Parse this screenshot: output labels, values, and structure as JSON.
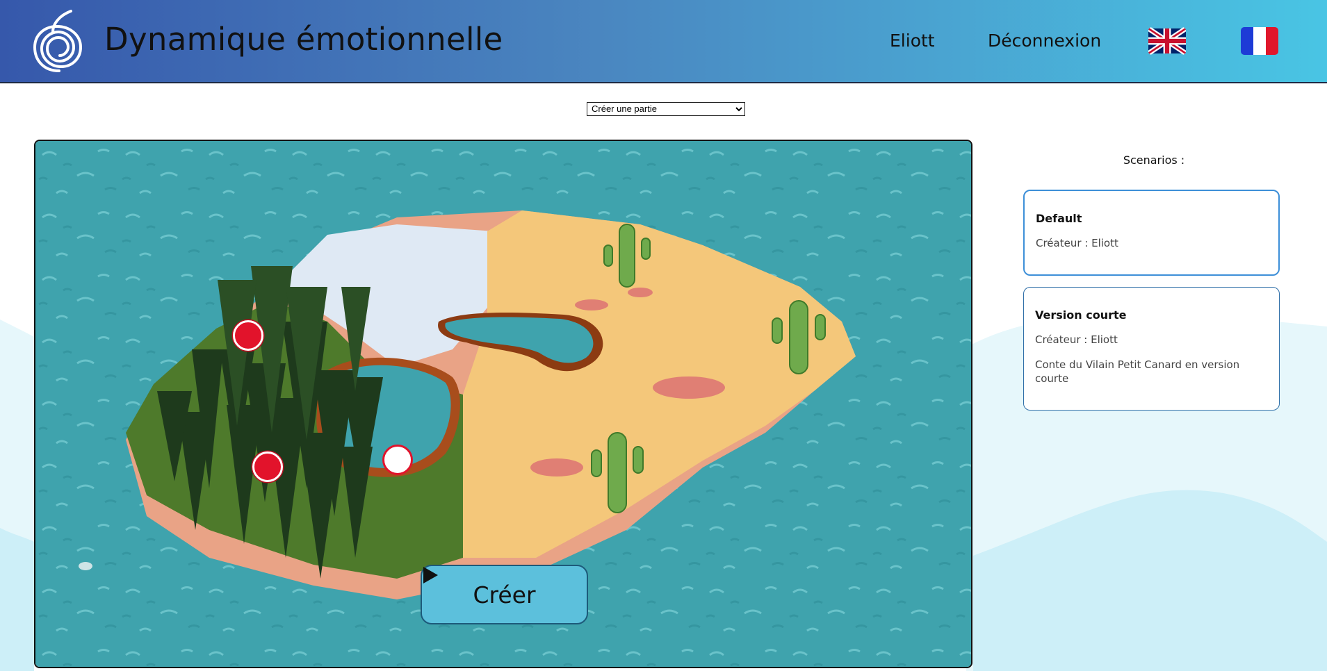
{
  "header": {
    "app_title": "Dynamique émotionnelle",
    "user_name": "Eliott",
    "logout_label": "Déconnexion",
    "flags": [
      "uk-flag-icon",
      "france-flag-icon"
    ]
  },
  "game_mode_select": {
    "selected": "Créer une partie"
  },
  "map": {
    "create_button_label": "Créer",
    "markers": [
      {
        "name": "map-marker-forest-top",
        "state": "active"
      },
      {
        "name": "map-marker-forest-bottom",
        "state": "active"
      },
      {
        "name": "map-marker-pond",
        "state": "inactive"
      }
    ]
  },
  "scenarios": {
    "title": "Scenarios :",
    "items": [
      {
        "name": "Default",
        "creator": "Créateur : Eliott",
        "description": ""
      },
      {
        "name": "Version courte",
        "creator": "Créateur : Eliott",
        "description": "Conte du Vilain Petit Canard en version courte"
      }
    ]
  },
  "colors": {
    "header_start": "#3658ab",
    "header_end": "#49c5e4",
    "water": "#3fa3ad",
    "marker_red": "#e2132b",
    "button": "#5cc0dc",
    "card_border": "#3d8fd8"
  }
}
